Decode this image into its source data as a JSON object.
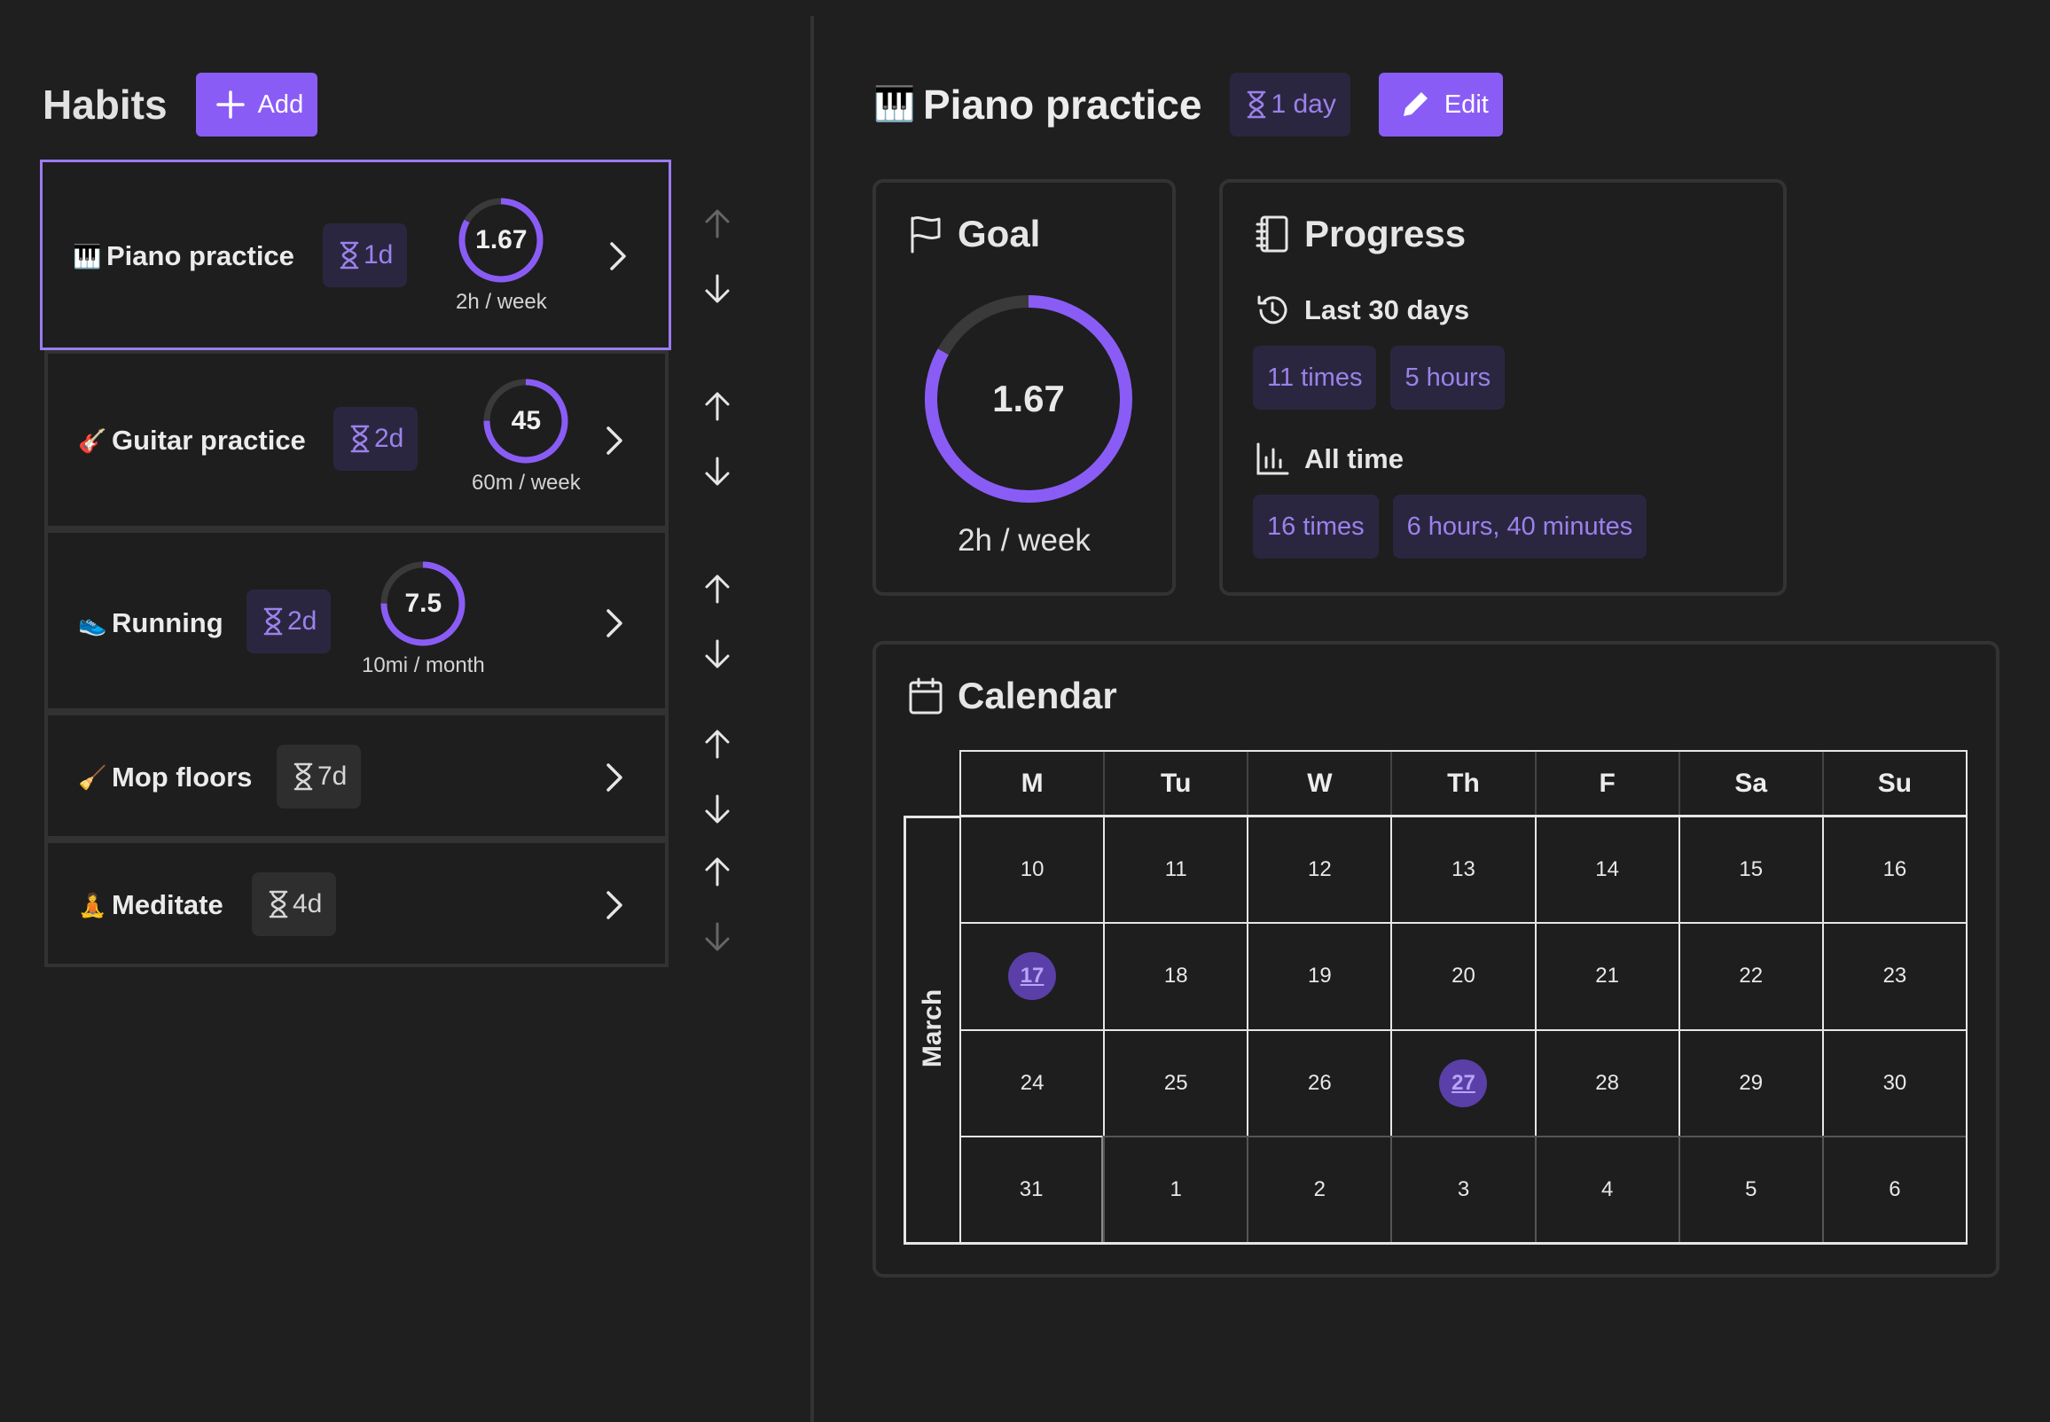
{
  "left": {
    "title": "Habits",
    "add_label": "Add",
    "habits": [
      {
        "emoji": "🎹",
        "name": "Piano practice",
        "badge": "1d",
        "value": "1.67",
        "subtitle": "2h / week",
        "progress": 0.83
      },
      {
        "emoji": "🎸",
        "name": "Guitar practice",
        "badge": "2d",
        "value": "45",
        "subtitle": "60m / week",
        "progress": 0.75
      },
      {
        "emoji": "👟",
        "name": "Running",
        "badge": "2d",
        "value": "7.5",
        "subtitle": "10mi / month",
        "progress": 0.75
      },
      {
        "emoji": "🧹",
        "name": "Mop floors",
        "badge": "7d"
      },
      {
        "emoji": "🧘",
        "name": "Meditate",
        "badge": "4d"
      }
    ]
  },
  "detail": {
    "emoji": "🎹",
    "title": "Piano practice",
    "badge": "1 day",
    "edit_label": "Edit",
    "goal": {
      "title": "Goal",
      "value": "1.67",
      "subtitle": "2h / week",
      "progress": 0.83
    },
    "progress": {
      "title": "Progress",
      "last30_label": "Last 30 days",
      "last30_times": "11 times",
      "last30_duration": "5 hours",
      "alltime_label": "All time",
      "alltime_times": "16 times",
      "alltime_duration": "6 hours, 40 minutes"
    },
    "calendar": {
      "title": "Calendar",
      "month": "March",
      "weekdays": [
        "M",
        "Tu",
        "W",
        "Th",
        "F",
        "Sa",
        "Su"
      ],
      "weeks": [
        [
          "10",
          "11",
          "12",
          "13",
          "14",
          "15",
          "16"
        ],
        [
          "17",
          "18",
          "19",
          "20",
          "21",
          "22",
          "23"
        ],
        [
          "24",
          "25",
          "26",
          "27",
          "28",
          "29",
          "30"
        ],
        [
          "31",
          "1",
          "2",
          "3",
          "4",
          "5",
          "6"
        ]
      ],
      "marked_days": [
        "17",
        "27"
      ]
    }
  },
  "colors": {
    "accent": "#8a5cf6",
    "badge_bg": "#2b2640",
    "badge_text": "#9a82ea",
    "background": "#1f1f1f"
  }
}
